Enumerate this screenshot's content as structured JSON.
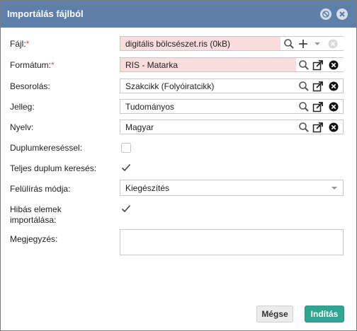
{
  "dialog": {
    "title": "Importálás fájlból",
    "colors": {
      "titlebar": "#5e7fa8",
      "required_field_bg": "#f9dcdc",
      "primary_button": "#2fa592"
    }
  },
  "form": {
    "file": {
      "label": "Fájl:",
      "required": "*",
      "value": "digitális bölcsészet.ris (0kB)"
    },
    "format": {
      "label": "Formátum:",
      "required": "*",
      "value": "RIS - Matarka"
    },
    "classification": {
      "label": "Besorolás:",
      "value": "Szakcikk (Folyóiratcikk)"
    },
    "type": {
      "label": "Jelleg:",
      "value": "Tudományos"
    },
    "language": {
      "label": "Nyelv:",
      "value": "Magyar"
    },
    "duplicate_search": {
      "label": "Duplumkereséssel:",
      "checked": false
    },
    "full_duplicate_search": {
      "label": "Teljes duplum keresés:",
      "checked": true
    },
    "overwrite_mode": {
      "label": "Felülírás módja:",
      "value": "Kiegészítés"
    },
    "import_faulty": {
      "label_line1": "Hibás elemek",
      "label_line2": "importálása:",
      "checked": true
    },
    "note": {
      "label": "Megjegyzés:",
      "value": ""
    }
  },
  "buttons": {
    "cancel": "Mégse",
    "start": "Indítás"
  },
  "icons": [
    "search-icon",
    "plus-icon",
    "chevron-down-icon",
    "clear-icon",
    "open-external-icon",
    "remove-icon",
    "check-icon",
    "minimize-icon",
    "close-icon"
  ]
}
